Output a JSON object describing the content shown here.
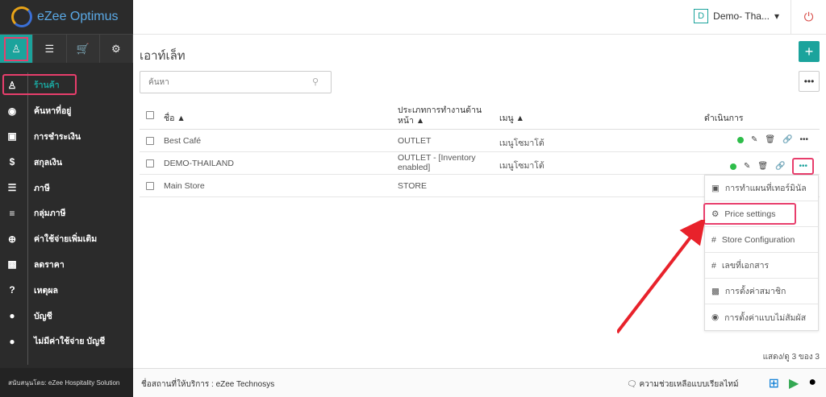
{
  "app": {
    "title": "eZee Optimus"
  },
  "sidebar": {
    "items": [
      {
        "label": "ร้านค้า",
        "icon": "user-icon",
        "active": true
      },
      {
        "label": "ค้นหาที่อยู่",
        "icon": "map-pin-icon"
      },
      {
        "label": "การชำระเงิน",
        "icon": "credit-card-icon"
      },
      {
        "label": "สกุลเงิน",
        "icon": "dollar-icon"
      },
      {
        "label": "ภาษี",
        "icon": "list-icon"
      },
      {
        "label": "กลุ่มภาษี",
        "icon": "list-bullets-icon"
      },
      {
        "label": "ค่าใช้จ่ายเพิ่มเติม",
        "icon": "plus-circle-icon"
      },
      {
        "label": "ลดราคา",
        "icon": "gift-icon"
      },
      {
        "label": "เหตุผล",
        "icon": "question-icon"
      },
      {
        "label": "บัญชี",
        "icon": "person-icon"
      },
      {
        "label": "ไม่มีค่าใช้จ่าย บัญชี",
        "icon": "person-icon"
      }
    ],
    "footer": "สนับสนุนโดย: eZee Hospitality Solution"
  },
  "header": {
    "property": "Demo- Tha...",
    "property_initial": "D"
  },
  "main": {
    "title": "เอาท์เล็ท",
    "search_placeholder": "ค้นหา",
    "columns": [
      "ชื่อ ▲",
      "ประเภทการทำงานด้าน หน้า ▲",
      "เมนู ▲",
      "ดำเนินการ"
    ],
    "rows": [
      {
        "name": "Best Café",
        "type": "OUTLET",
        "menu": "เมนูโซมาโต้"
      },
      {
        "name": "DEMO-THAILAND",
        "type": "OUTLET - [Inventory enabled]",
        "menu": "เมนูโซมาโต้"
      },
      {
        "name": "Main Store",
        "type": "STORE",
        "menu": ""
      }
    ],
    "dropdown": [
      {
        "label": "การทำแผนที่เทอร์มินัล",
        "icon": "monitor-icon"
      },
      {
        "label": "Price settings",
        "icon": "gear-icon"
      },
      {
        "label": "Store Configuration",
        "icon": "hash-icon"
      },
      {
        "label": "เลขที่เอกสาร",
        "icon": "hash-icon"
      },
      {
        "label": "การตั้งค่าสมาชิก",
        "icon": "gift-icon"
      },
      {
        "label": "การตั้งค่าแบบไม่สัมผัส",
        "icon": "eye-icon"
      }
    ],
    "count": "แสดง/ดู 3 ของ 3"
  },
  "bottom_bar": {
    "provider": "ชื่อสถานที่ให้บริการ : eZee Technosys",
    "help": "ความช่วยเหลือแบบเรียลไทม์"
  },
  "colors": {
    "accent": "#1ba39c",
    "highlight": "#e83e6c",
    "status": "#2ebd4a"
  }
}
